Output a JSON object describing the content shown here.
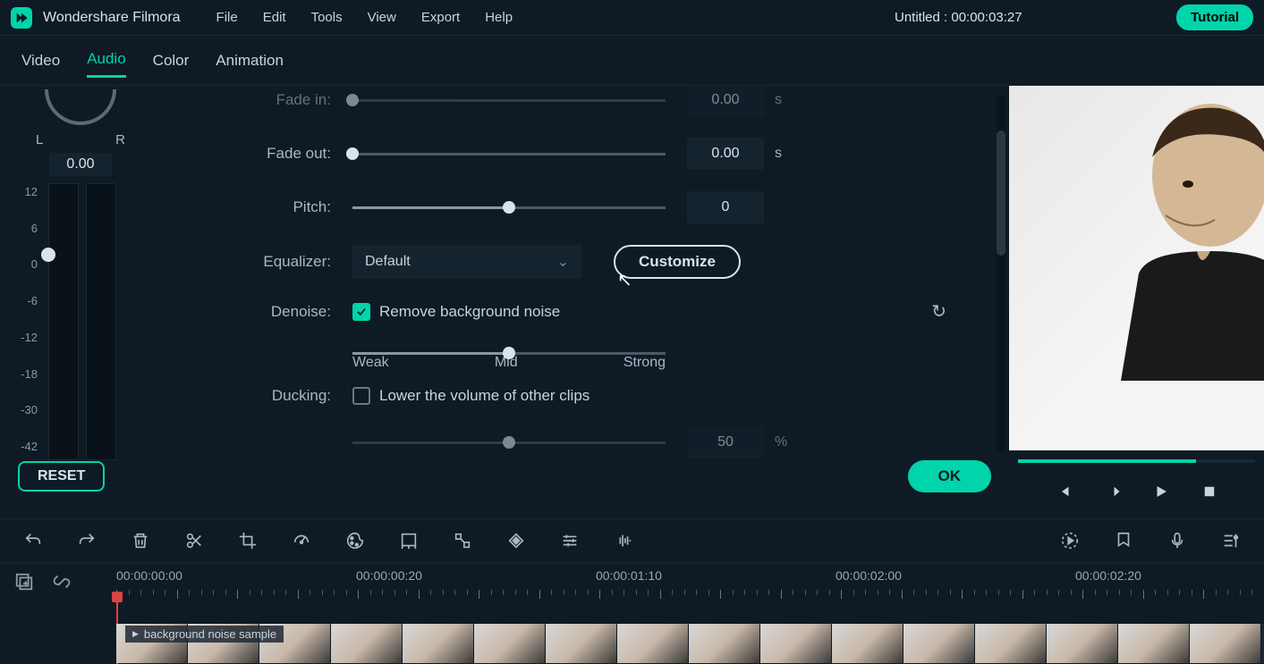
{
  "app": {
    "name": "Wondershare Filmora",
    "title": "Untitled : 00:00:03:27",
    "tutorial": "Tutorial"
  },
  "menu": {
    "file": "File",
    "edit": "Edit",
    "tools": "Tools",
    "view": "View",
    "export": "Export",
    "help": "Help"
  },
  "tabs": {
    "video": "Video",
    "audio": "Audio",
    "color": "Color",
    "animation": "Animation"
  },
  "balance": {
    "left": "L",
    "right": "R",
    "value": "0.00"
  },
  "vu_scale": [
    "12",
    "6",
    "0",
    "-6",
    "-12",
    "-18",
    "-30",
    "-42"
  ],
  "audio": {
    "fade_in": {
      "label": "Fade in:",
      "value": "0.00",
      "unit": "s"
    },
    "fade_out": {
      "label": "Fade out:",
      "value": "0.00",
      "unit": "s"
    },
    "pitch": {
      "label": "Pitch:",
      "value": "0"
    },
    "equalizer": {
      "label": "Equalizer:",
      "selected": "Default",
      "customize": "Customize"
    },
    "denoise": {
      "label": "Denoise:",
      "checkbox_label": "Remove background noise",
      "weak": "Weak",
      "mid": "Mid",
      "strong": "Strong"
    },
    "ducking": {
      "label": "Ducking:",
      "checkbox_label": "Lower the volume of other clips",
      "value": "50",
      "unit": "%"
    }
  },
  "buttons": {
    "reset": "RESET",
    "ok": "OK"
  },
  "timeline": {
    "times": [
      "00:00:00:00",
      "00:00:00:20",
      "00:00:01:10",
      "00:00:02:00",
      "00:00:02:20"
    ],
    "clip_label": "background noise sample"
  }
}
